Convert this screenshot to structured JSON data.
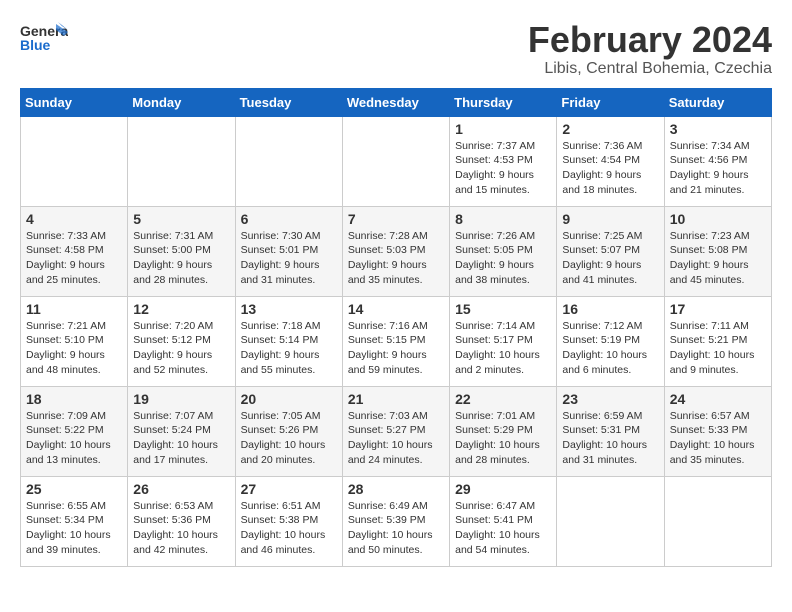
{
  "logo": {
    "general": "General",
    "blue": "Blue"
  },
  "title": "February 2024",
  "subtitle": "Libis, Central Bohemia, Czechia",
  "weekdays": [
    "Sunday",
    "Monday",
    "Tuesday",
    "Wednesday",
    "Thursday",
    "Friday",
    "Saturday"
  ],
  "weeks": [
    [
      {
        "day": "",
        "info": ""
      },
      {
        "day": "",
        "info": ""
      },
      {
        "day": "",
        "info": ""
      },
      {
        "day": "",
        "info": ""
      },
      {
        "day": "1",
        "info": "Sunrise: 7:37 AM\nSunset: 4:53 PM\nDaylight: 9 hours\nand 15 minutes."
      },
      {
        "day": "2",
        "info": "Sunrise: 7:36 AM\nSunset: 4:54 PM\nDaylight: 9 hours\nand 18 minutes."
      },
      {
        "day": "3",
        "info": "Sunrise: 7:34 AM\nSunset: 4:56 PM\nDaylight: 9 hours\nand 21 minutes."
      }
    ],
    [
      {
        "day": "4",
        "info": "Sunrise: 7:33 AM\nSunset: 4:58 PM\nDaylight: 9 hours\nand 25 minutes."
      },
      {
        "day": "5",
        "info": "Sunrise: 7:31 AM\nSunset: 5:00 PM\nDaylight: 9 hours\nand 28 minutes."
      },
      {
        "day": "6",
        "info": "Sunrise: 7:30 AM\nSunset: 5:01 PM\nDaylight: 9 hours\nand 31 minutes."
      },
      {
        "day": "7",
        "info": "Sunrise: 7:28 AM\nSunset: 5:03 PM\nDaylight: 9 hours\nand 35 minutes."
      },
      {
        "day": "8",
        "info": "Sunrise: 7:26 AM\nSunset: 5:05 PM\nDaylight: 9 hours\nand 38 minutes."
      },
      {
        "day": "9",
        "info": "Sunrise: 7:25 AM\nSunset: 5:07 PM\nDaylight: 9 hours\nand 41 minutes."
      },
      {
        "day": "10",
        "info": "Sunrise: 7:23 AM\nSunset: 5:08 PM\nDaylight: 9 hours\nand 45 minutes."
      }
    ],
    [
      {
        "day": "11",
        "info": "Sunrise: 7:21 AM\nSunset: 5:10 PM\nDaylight: 9 hours\nand 48 minutes."
      },
      {
        "day": "12",
        "info": "Sunrise: 7:20 AM\nSunset: 5:12 PM\nDaylight: 9 hours\nand 52 minutes."
      },
      {
        "day": "13",
        "info": "Sunrise: 7:18 AM\nSunset: 5:14 PM\nDaylight: 9 hours\nand 55 minutes."
      },
      {
        "day": "14",
        "info": "Sunrise: 7:16 AM\nSunset: 5:15 PM\nDaylight: 9 hours\nand 59 minutes."
      },
      {
        "day": "15",
        "info": "Sunrise: 7:14 AM\nSunset: 5:17 PM\nDaylight: 10 hours\nand 2 minutes."
      },
      {
        "day": "16",
        "info": "Sunrise: 7:12 AM\nSunset: 5:19 PM\nDaylight: 10 hours\nand 6 minutes."
      },
      {
        "day": "17",
        "info": "Sunrise: 7:11 AM\nSunset: 5:21 PM\nDaylight: 10 hours\nand 9 minutes."
      }
    ],
    [
      {
        "day": "18",
        "info": "Sunrise: 7:09 AM\nSunset: 5:22 PM\nDaylight: 10 hours\nand 13 minutes."
      },
      {
        "day": "19",
        "info": "Sunrise: 7:07 AM\nSunset: 5:24 PM\nDaylight: 10 hours\nand 17 minutes."
      },
      {
        "day": "20",
        "info": "Sunrise: 7:05 AM\nSunset: 5:26 PM\nDaylight: 10 hours\nand 20 minutes."
      },
      {
        "day": "21",
        "info": "Sunrise: 7:03 AM\nSunset: 5:27 PM\nDaylight: 10 hours\nand 24 minutes."
      },
      {
        "day": "22",
        "info": "Sunrise: 7:01 AM\nSunset: 5:29 PM\nDaylight: 10 hours\nand 28 minutes."
      },
      {
        "day": "23",
        "info": "Sunrise: 6:59 AM\nSunset: 5:31 PM\nDaylight: 10 hours\nand 31 minutes."
      },
      {
        "day": "24",
        "info": "Sunrise: 6:57 AM\nSunset: 5:33 PM\nDaylight: 10 hours\nand 35 minutes."
      }
    ],
    [
      {
        "day": "25",
        "info": "Sunrise: 6:55 AM\nSunset: 5:34 PM\nDaylight: 10 hours\nand 39 minutes."
      },
      {
        "day": "26",
        "info": "Sunrise: 6:53 AM\nSunset: 5:36 PM\nDaylight: 10 hours\nand 42 minutes."
      },
      {
        "day": "27",
        "info": "Sunrise: 6:51 AM\nSunset: 5:38 PM\nDaylight: 10 hours\nand 46 minutes."
      },
      {
        "day": "28",
        "info": "Sunrise: 6:49 AM\nSunset: 5:39 PM\nDaylight: 10 hours\nand 50 minutes."
      },
      {
        "day": "29",
        "info": "Sunrise: 6:47 AM\nSunset: 5:41 PM\nDaylight: 10 hours\nand 54 minutes."
      },
      {
        "day": "",
        "info": ""
      },
      {
        "day": "",
        "info": ""
      }
    ]
  ]
}
